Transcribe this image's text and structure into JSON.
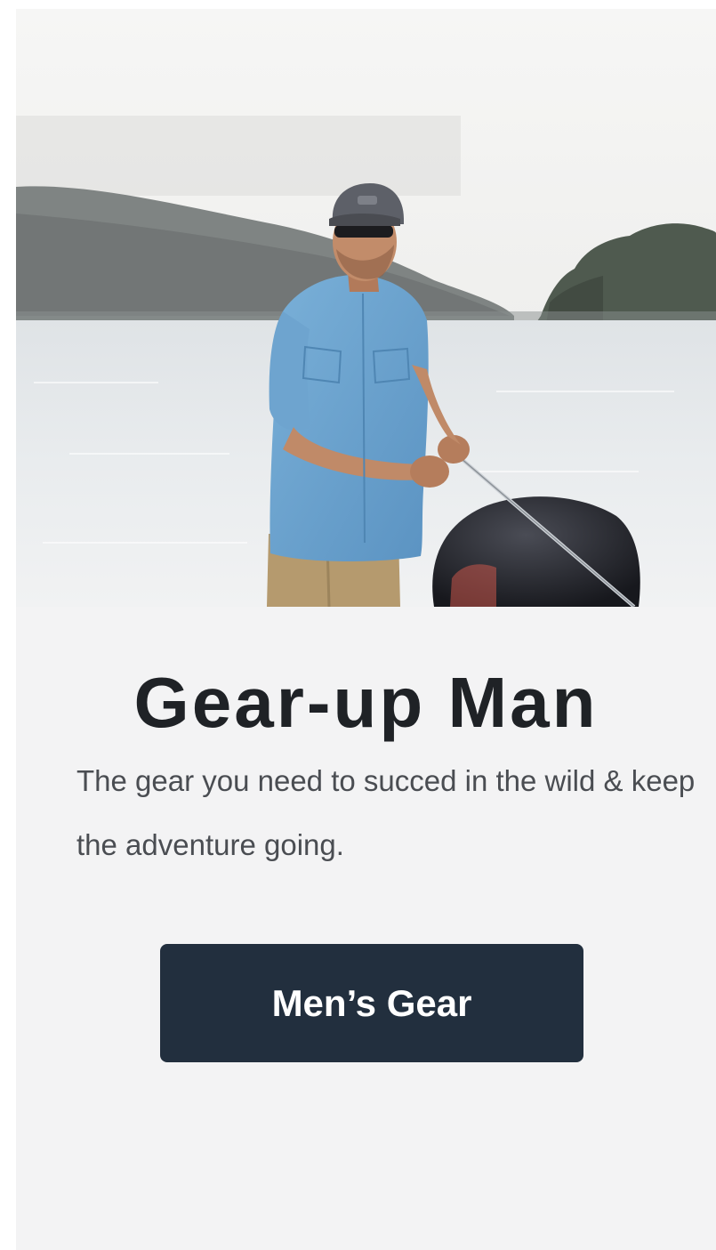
{
  "promo": {
    "headline": "Gear-up Man",
    "subtext": "The gear you need to succed in the wild & keep the adventure going.",
    "cta_label": "Men’s Gear"
  },
  "colors": {
    "card_background": "#f3f3f4",
    "headline": "#1f2226",
    "subtext": "#4a4d52",
    "button_background": "#222f3e",
    "button_text": "#ffffff"
  },
  "hero": {
    "scene": "hero-photo-man-fishing-on-boat"
  }
}
